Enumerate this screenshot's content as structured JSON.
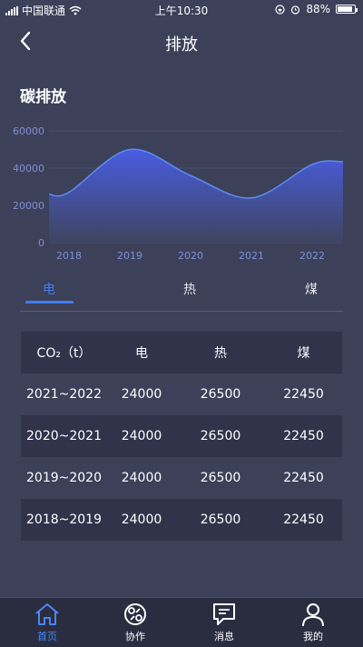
{
  "status_bar": {
    "carrier": "中国联通",
    "time": "上午10:30",
    "battery": "88%",
    "battery_level": 0.88
  },
  "nav": {
    "title": "排放"
  },
  "section": {
    "title": "碳排放"
  },
  "chart_data": {
    "type": "area",
    "title": "",
    "xlabel": "",
    "ylabel": "",
    "x": [
      "2018",
      "2019",
      "2020",
      "2021",
      "2022"
    ],
    "y_ticks": [
      "0",
      "20000",
      "40000",
      "60000"
    ],
    "ylim": [
      0,
      60000
    ],
    "series": [
      {
        "values": [
          27000,
          50000,
          36000,
          24000,
          42000
        ]
      }
    ],
    "grid": true,
    "colors": {
      "line": "#5b8df5",
      "fill_top": "#4a64e6",
      "fill_bottom": "#3a4260"
    }
  },
  "tabs": [
    {
      "label": "电",
      "active": true
    },
    {
      "label": "热",
      "active": false
    },
    {
      "label": "煤",
      "active": false
    }
  ],
  "table": {
    "headers": [
      "CO₂（t）",
      "电",
      "热",
      "煤"
    ],
    "rows": [
      [
        "2021~2022",
        "24000",
        "26500",
        "22450"
      ],
      [
        "2020~2021",
        "24000",
        "26500",
        "22450"
      ],
      [
        "2019~2020",
        "24000",
        "26500",
        "22450"
      ],
      [
        "2018~2019",
        "24000",
        "26500",
        "22450"
      ]
    ]
  },
  "bottom_tabs": [
    {
      "label": "首页",
      "icon": "home-icon",
      "active": true
    },
    {
      "label": "协作",
      "icon": "collaborate-icon",
      "active": false
    },
    {
      "label": "消息",
      "icon": "message-icon",
      "active": false
    },
    {
      "label": "我的",
      "icon": "profile-icon",
      "active": false
    }
  ],
  "accent_color": "#3f7cf5"
}
